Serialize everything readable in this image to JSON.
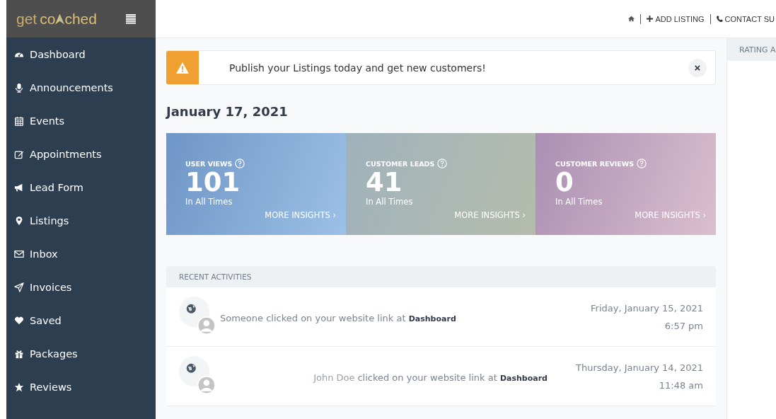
{
  "logo": {
    "parts": [
      "get",
      "co",
      "ched"
    ]
  },
  "sidebar": {
    "items": [
      {
        "label": "Dashboard",
        "kind": "dashboard"
      },
      {
        "label": "Announcements",
        "kind": "mic"
      },
      {
        "label": "Events",
        "kind": "calendar"
      },
      {
        "label": "Appointments",
        "kind": "edit"
      },
      {
        "label": "Lead Form",
        "kind": "megaphone"
      },
      {
        "label": "Listings",
        "kind": "pin"
      },
      {
        "label": "Inbox",
        "kind": "envelope"
      },
      {
        "label": "Invoices",
        "kind": "plane"
      },
      {
        "label": "Saved",
        "kind": "heart"
      },
      {
        "label": "Packages",
        "kind": "gift"
      },
      {
        "label": "Reviews",
        "kind": "star"
      }
    ]
  },
  "top_links": [
    {
      "kind": "home"
    },
    {
      "kind": "add",
      "label": "ADD LISTING"
    },
    {
      "kind": "phone",
      "label": "CONTACT SU"
    }
  ],
  "alert": {
    "message": "Publish your Listings today and get new customers!",
    "close": "×"
  },
  "date": "January 17, 2021",
  "stats": [
    {
      "title": "USER VIEWS",
      "value": "101",
      "caption": "In All Times",
      "link": "MORE INSIGHTS ›"
    },
    {
      "title": "CUSTOMER LEADS",
      "value": "41",
      "caption": "In All Times",
      "link": "MORE INSIGHTS ›"
    },
    {
      "title": "CUSTOMER REVIEWS",
      "value": "0",
      "caption": "In All Times",
      "link": "MORE INSIGHTS ›"
    }
  ],
  "activities": {
    "title": "RECENT ACTIVITIES",
    "rows": [
      {
        "text": "Someone clicked on your website link at",
        "link": "Dashboard",
        "date": "Friday, January 15, 2021",
        "time": "6:57 pm"
      },
      {
        "actor": "John Doe",
        "text": "clicked on your website link at",
        "link": "Dashboard",
        "date": "Thursday, January 14, 2021",
        "time": "11:48 am"
      }
    ]
  },
  "right_panel": {
    "title": "RATING A"
  }
}
